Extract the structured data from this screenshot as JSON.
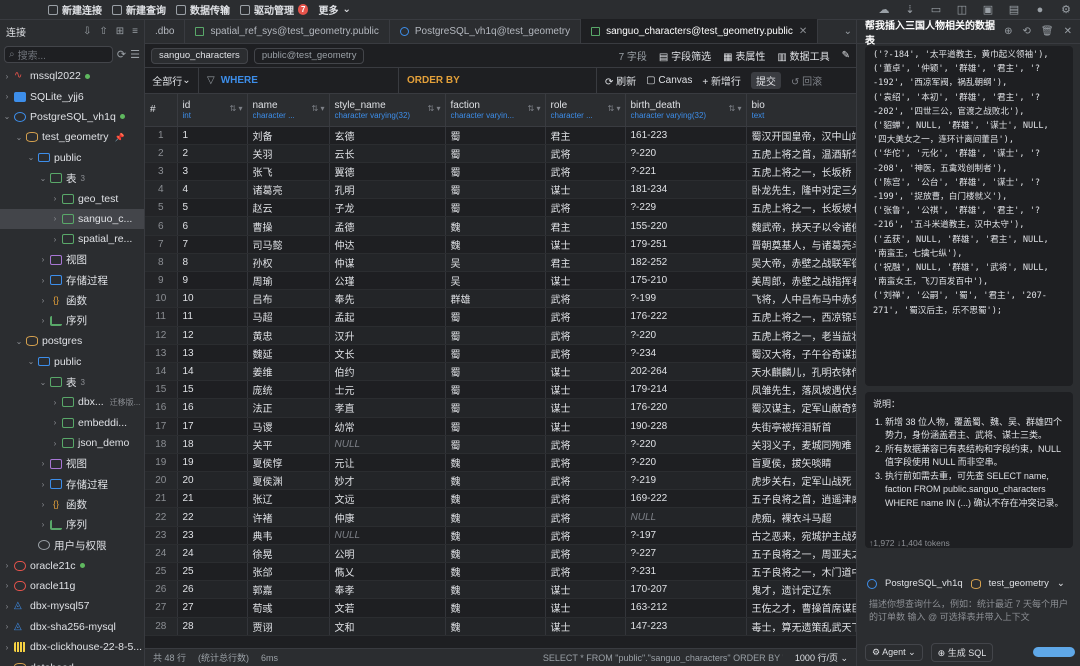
{
  "topbar": {
    "items": [
      {
        "label": "新建连接"
      },
      {
        "label": "新建查询"
      },
      {
        "label": "数据传输"
      },
      {
        "label": "驱动管理",
        "badge": "7"
      },
      {
        "label": "更多"
      }
    ]
  },
  "sidebar": {
    "title": "连接",
    "search_placeholder": "搜索...",
    "nodes": [
      {
        "label": "mssql2022",
        "icon": "mssql-icon",
        "level": 0,
        "arrow": "›",
        "online": true
      },
      {
        "label": "SQLite_yjj6",
        "icon": "sqlite-icon",
        "level": 0,
        "arrow": "›"
      },
      {
        "label": "PostgreSQL_vh1q",
        "icon": "postgres-icon",
        "level": 0,
        "arrow": "⌄",
        "online": true
      },
      {
        "label": "test_geometry",
        "icon": "database-icon",
        "level": 1,
        "arrow": "⌄",
        "pin": "📌"
      },
      {
        "label": "public",
        "icon": "schema-icon",
        "level": 2,
        "arrow": "⌄"
      },
      {
        "label": "表",
        "icon": "table-icon",
        "level": 3,
        "arrow": "⌄",
        "count": "3"
      },
      {
        "label": "geo_test",
        "icon": "table-icon",
        "level": 4,
        "arrow": "›"
      },
      {
        "label": "sanguo_c...",
        "icon": "table-icon",
        "level": 4,
        "arrow": "›",
        "selected": true
      },
      {
        "label": "spatial_re...",
        "icon": "table-icon",
        "level": 4,
        "arrow": "›"
      },
      {
        "label": "视图",
        "icon": "view-icon",
        "level": 3,
        "arrow": "›"
      },
      {
        "label": "存储过程",
        "icon": "procedure-icon",
        "level": 3,
        "arrow": "›"
      },
      {
        "label": "函数",
        "icon": "function-icon",
        "level": 3,
        "arrow": "›"
      },
      {
        "label": "序列",
        "icon": "sequence-icon",
        "level": 3,
        "arrow": "›"
      },
      {
        "label": "postgres",
        "icon": "database-icon",
        "level": 1,
        "arrow": "⌄"
      },
      {
        "label": "public",
        "icon": "schema-icon",
        "level": 2,
        "arrow": "⌄"
      },
      {
        "label": "表",
        "icon": "table-icon",
        "level": 3,
        "arrow": "⌄",
        "count": "3"
      },
      {
        "label": "dbx...",
        "icon": "table-icon",
        "level": 4,
        "arrow": "›",
        "tag": "迁移版..."
      },
      {
        "label": "embeddi...",
        "icon": "table-icon",
        "level": 4,
        "arrow": "›"
      },
      {
        "label": "json_demo",
        "icon": "table-icon",
        "level": 4,
        "arrow": "›"
      },
      {
        "label": "视图",
        "icon": "view-icon",
        "level": 3,
        "arrow": "›"
      },
      {
        "label": "存储过程",
        "icon": "procedure-icon",
        "level": 3,
        "arrow": "›"
      },
      {
        "label": "函数",
        "icon": "function-icon",
        "level": 3,
        "arrow": "›"
      },
      {
        "label": "序列",
        "icon": "sequence-icon",
        "level": 3,
        "arrow": "›"
      },
      {
        "label": "用户与权限",
        "icon": "user-icon",
        "level": 2,
        "arrow": ""
      },
      {
        "label": "oracle21c",
        "icon": "oracle-icon",
        "level": 0,
        "arrow": "›",
        "online": true
      },
      {
        "label": "oracle11g",
        "icon": "oracle-icon",
        "level": 0,
        "arrow": "›"
      },
      {
        "label": "dbx-mysql57",
        "icon": "mysql-icon",
        "level": 0,
        "arrow": "›"
      },
      {
        "label": "dbx-sha256-mysql",
        "icon": "mysql-icon",
        "level": 0,
        "arrow": "›"
      },
      {
        "label": "dbx-clickhouse-22-8-5...",
        "icon": "clickhouse-icon",
        "level": 0,
        "arrow": "›"
      },
      {
        "label": "datahead",
        "icon": "database-icon",
        "level": 0,
        "arrow": "›"
      }
    ]
  },
  "tabs": [
    {
      "label": ".dbo",
      "icon": "",
      "active": false
    },
    {
      "label": "spatial_ref_sys@test_geometry.public",
      "icon": "table",
      "active": false
    },
    {
      "label": "PostgreSQL_vh1q@test_geometry",
      "icon": "code",
      "active": false
    },
    {
      "label": "sanguo_characters@test_geometry.public",
      "icon": "table",
      "active": true
    }
  ],
  "breadcrumb": {
    "table": "sanguo_characters",
    "schema": "public@test_geometry",
    "field_count": "7 字段",
    "field_filter": "字段筛选",
    "table_props": "表属性",
    "data_tools": "数据工具"
  },
  "filter": {
    "all_rows": "全部行",
    "where": "WHERE",
    "order_by": "ORDER BY",
    "refresh": "刷新",
    "canvas": "Canvas",
    "add_row": "新增行",
    "submit": "提交",
    "rollback": "回滚"
  },
  "grid": {
    "columns": [
      {
        "name": "#",
        "type": ""
      },
      {
        "name": "id",
        "type": "int"
      },
      {
        "name": "name",
        "type": "character ..."
      },
      {
        "name": "style_name",
        "type": "character varying(32)"
      },
      {
        "name": "faction",
        "type": "character varyin..."
      },
      {
        "name": "role",
        "type": "character ..."
      },
      {
        "name": "birth_death",
        "type": "character varying(32)"
      },
      {
        "name": "bio",
        "type": "text"
      }
    ],
    "rows": [
      [
        "1",
        "1",
        "刘备",
        "玄德",
        "蜀",
        "君主",
        "161-223",
        "蜀汉开国皇帝，汉中山靖"
      ],
      [
        "2",
        "2",
        "关羽",
        "云长",
        "蜀",
        "武将",
        "?-220",
        "五虎上将之首，温酒斩华"
      ],
      [
        "3",
        "3",
        "张飞",
        "翼德",
        "蜀",
        "武将",
        "?-221",
        "五虎上将之一，长坂桥"
      ],
      [
        "4",
        "4",
        "诸葛亮",
        "孔明",
        "蜀",
        "谋士",
        "181-234",
        "卧龙先生，隆中对定三分"
      ],
      [
        "5",
        "5",
        "赵云",
        "子龙",
        "蜀",
        "武将",
        "?-229",
        "五虎上将之一，长坂坡七"
      ],
      [
        "6",
        "6",
        "曹操",
        "孟德",
        "魏",
        "君主",
        "155-220",
        "魏武帝，挟天子以令诸侯"
      ],
      [
        "7",
        "7",
        "司马懿",
        "仲达",
        "魏",
        "谋士",
        "179-251",
        "晋朝奠基人，与诸葛亮斗"
      ],
      [
        "8",
        "8",
        "孙权",
        "仲谋",
        "吴",
        "君主",
        "182-252",
        "吴大帝，赤壁之战联军御"
      ],
      [
        "9",
        "9",
        "周瑜",
        "公瑾",
        "吴",
        "谋士",
        "175-210",
        "美周郎，赤壁之战指挥者"
      ],
      [
        "10",
        "10",
        "吕布",
        "奉先",
        "群雄",
        "武将",
        "?-199",
        "飞将，人中吕布马中赤兔"
      ],
      [
        "11",
        "11",
        "马超",
        "孟起",
        "蜀",
        "武将",
        "176-222",
        "五虎上将之一，西凉锦马"
      ],
      [
        "12",
        "12",
        "黄忠",
        "汉升",
        "蜀",
        "武将",
        "?-220",
        "五虎上将之一，老当益壮"
      ],
      [
        "13",
        "13",
        "魏延",
        "文长",
        "蜀",
        "武将",
        "?-234",
        "蜀汉大将，子午谷奇谋提"
      ],
      [
        "14",
        "14",
        "姜维",
        "伯约",
        "蜀",
        "谋士",
        "202-264",
        "天水麒麟儿，孔明衣钵传"
      ],
      [
        "15",
        "15",
        "庞统",
        "士元",
        "蜀",
        "谋士",
        "179-214",
        "凤雏先生，落凤坡遇伏身"
      ],
      [
        "16",
        "16",
        "法正",
        "孝直",
        "蜀",
        "谋士",
        "176-220",
        "蜀汉谋主，定军山献奇策"
      ],
      [
        "17",
        "17",
        "马谡",
        "幼常",
        "蜀",
        "谋士",
        "190-228",
        "失街亭被挥泪斩首"
      ],
      [
        "18",
        "18",
        "关平",
        "NULL",
        "蜀",
        "武将",
        "?-220",
        "关羽义子，麦城同殉难"
      ],
      [
        "19",
        "19",
        "夏侯惇",
        "元让",
        "魏",
        "武将",
        "?-220",
        "盲夏侯，拔矢啖睛"
      ],
      [
        "20",
        "20",
        "夏侯渊",
        "妙才",
        "魏",
        "武将",
        "?-219",
        "虎步关右，定军山战死"
      ],
      [
        "21",
        "21",
        "张辽",
        "文远",
        "魏",
        "武将",
        "169-222",
        "五子良将之首，逍遥津威"
      ],
      [
        "22",
        "22",
        "许褚",
        "仲康",
        "魏",
        "武将",
        "NULL",
        "虎痴，裸衣斗马超"
      ],
      [
        "23",
        "23",
        "典韦",
        "NULL",
        "魏",
        "武将",
        "?-197",
        "古之恶来，宛城护主战死"
      ],
      [
        "24",
        "24",
        "徐晃",
        "公明",
        "魏",
        "武将",
        "?-227",
        "五子良将之一，周亚夫之"
      ],
      [
        "25",
        "25",
        "张郃",
        "儁乂",
        "魏",
        "武将",
        "?-231",
        "五子良将之一，木门道中"
      ],
      [
        "26",
        "26",
        "郭嘉",
        "奉孝",
        "魏",
        "谋士",
        "170-207",
        "鬼才，遗计定辽东"
      ],
      [
        "27",
        "27",
        "荀彧",
        "文若",
        "魏",
        "谋士",
        "163-212",
        "王佐之才，曹操首席谋臣"
      ],
      [
        "28",
        "28",
        "贾诩",
        "文和",
        "魏",
        "谋士",
        "147-223",
        "毒士，算无遗策乱武天下"
      ]
    ]
  },
  "status": {
    "total": "共 48 行",
    "stats": "(统计总行数)",
    "time": "6ms",
    "sql": "SELECT * FROM \"public\".\"sanguo_characters\" ORDER BY \"id\" AS...",
    "page_size": "1000 行/页"
  },
  "chat": {
    "title": "帮我插入三国人物相关的数据表",
    "code_lines": [
      "('?-184', '太平道教主，黄巾起义领袖'),",
      "('董卓', '仲颖', '群雄', '君主', '?-192', '西凉军阀，祸乱朝纲'),",
      "('袁绍', '本初', '群雄', '君主', '?-202', '四世三公，官渡之战败北'),",
      "('貂蝉', NULL, '群雄', '谋士', NULL, '四大美女之一，连环计离间董吕'),",
      "('华佗', '元化', '群雄', '谋士', '?-208', '神医，五禽戏创制者'),",
      "('陈宫', '公台', '群雄', '谋士', '?-199', '捉放曹，白门楼就义'),",
      "('张鲁', '公祺', '群雄', '君主', '?-216', '五斗米道教主，汉中太守'),",
      "('孟获', NULL, '群雄', '君主', NULL, '南蛮王，七擒七纵'),",
      "('祝融', NULL, '群雄', '武将', NULL, '南蛮女王，飞刀百发百中'),",
      "('刘禅', '公嗣', '蜀', '君主', '207-271', '蜀汉后主，乐不思蜀');"
    ],
    "explain_title": "说明：",
    "explain_items": [
      "新增 38 位人物，覆盖蜀、魏、吴、群雄四个势力，身份涵盖君主、武将、谋士三类。",
      "所有数据兼容已有表结构和字段约束，NULL 值字段使用 NULL 而非空串。",
      "执行前如需去重，可先查 SELECT name, faction FROM public.sanguo_characters WHERE name IN (...) 确认不存在冲突记录。"
    ],
    "tokens": "↑1,972 ↓1,404 tokens",
    "connection": "PostgreSQL_vh1q",
    "database": "test_geometry",
    "prompt_placeholder": "描述你想查询什么，例如：统计最近 7 天每个用户的订单数 输入 @ 可选择表并带入上下文",
    "agent_label": "Agent",
    "gen_label": "生成 SQL"
  }
}
